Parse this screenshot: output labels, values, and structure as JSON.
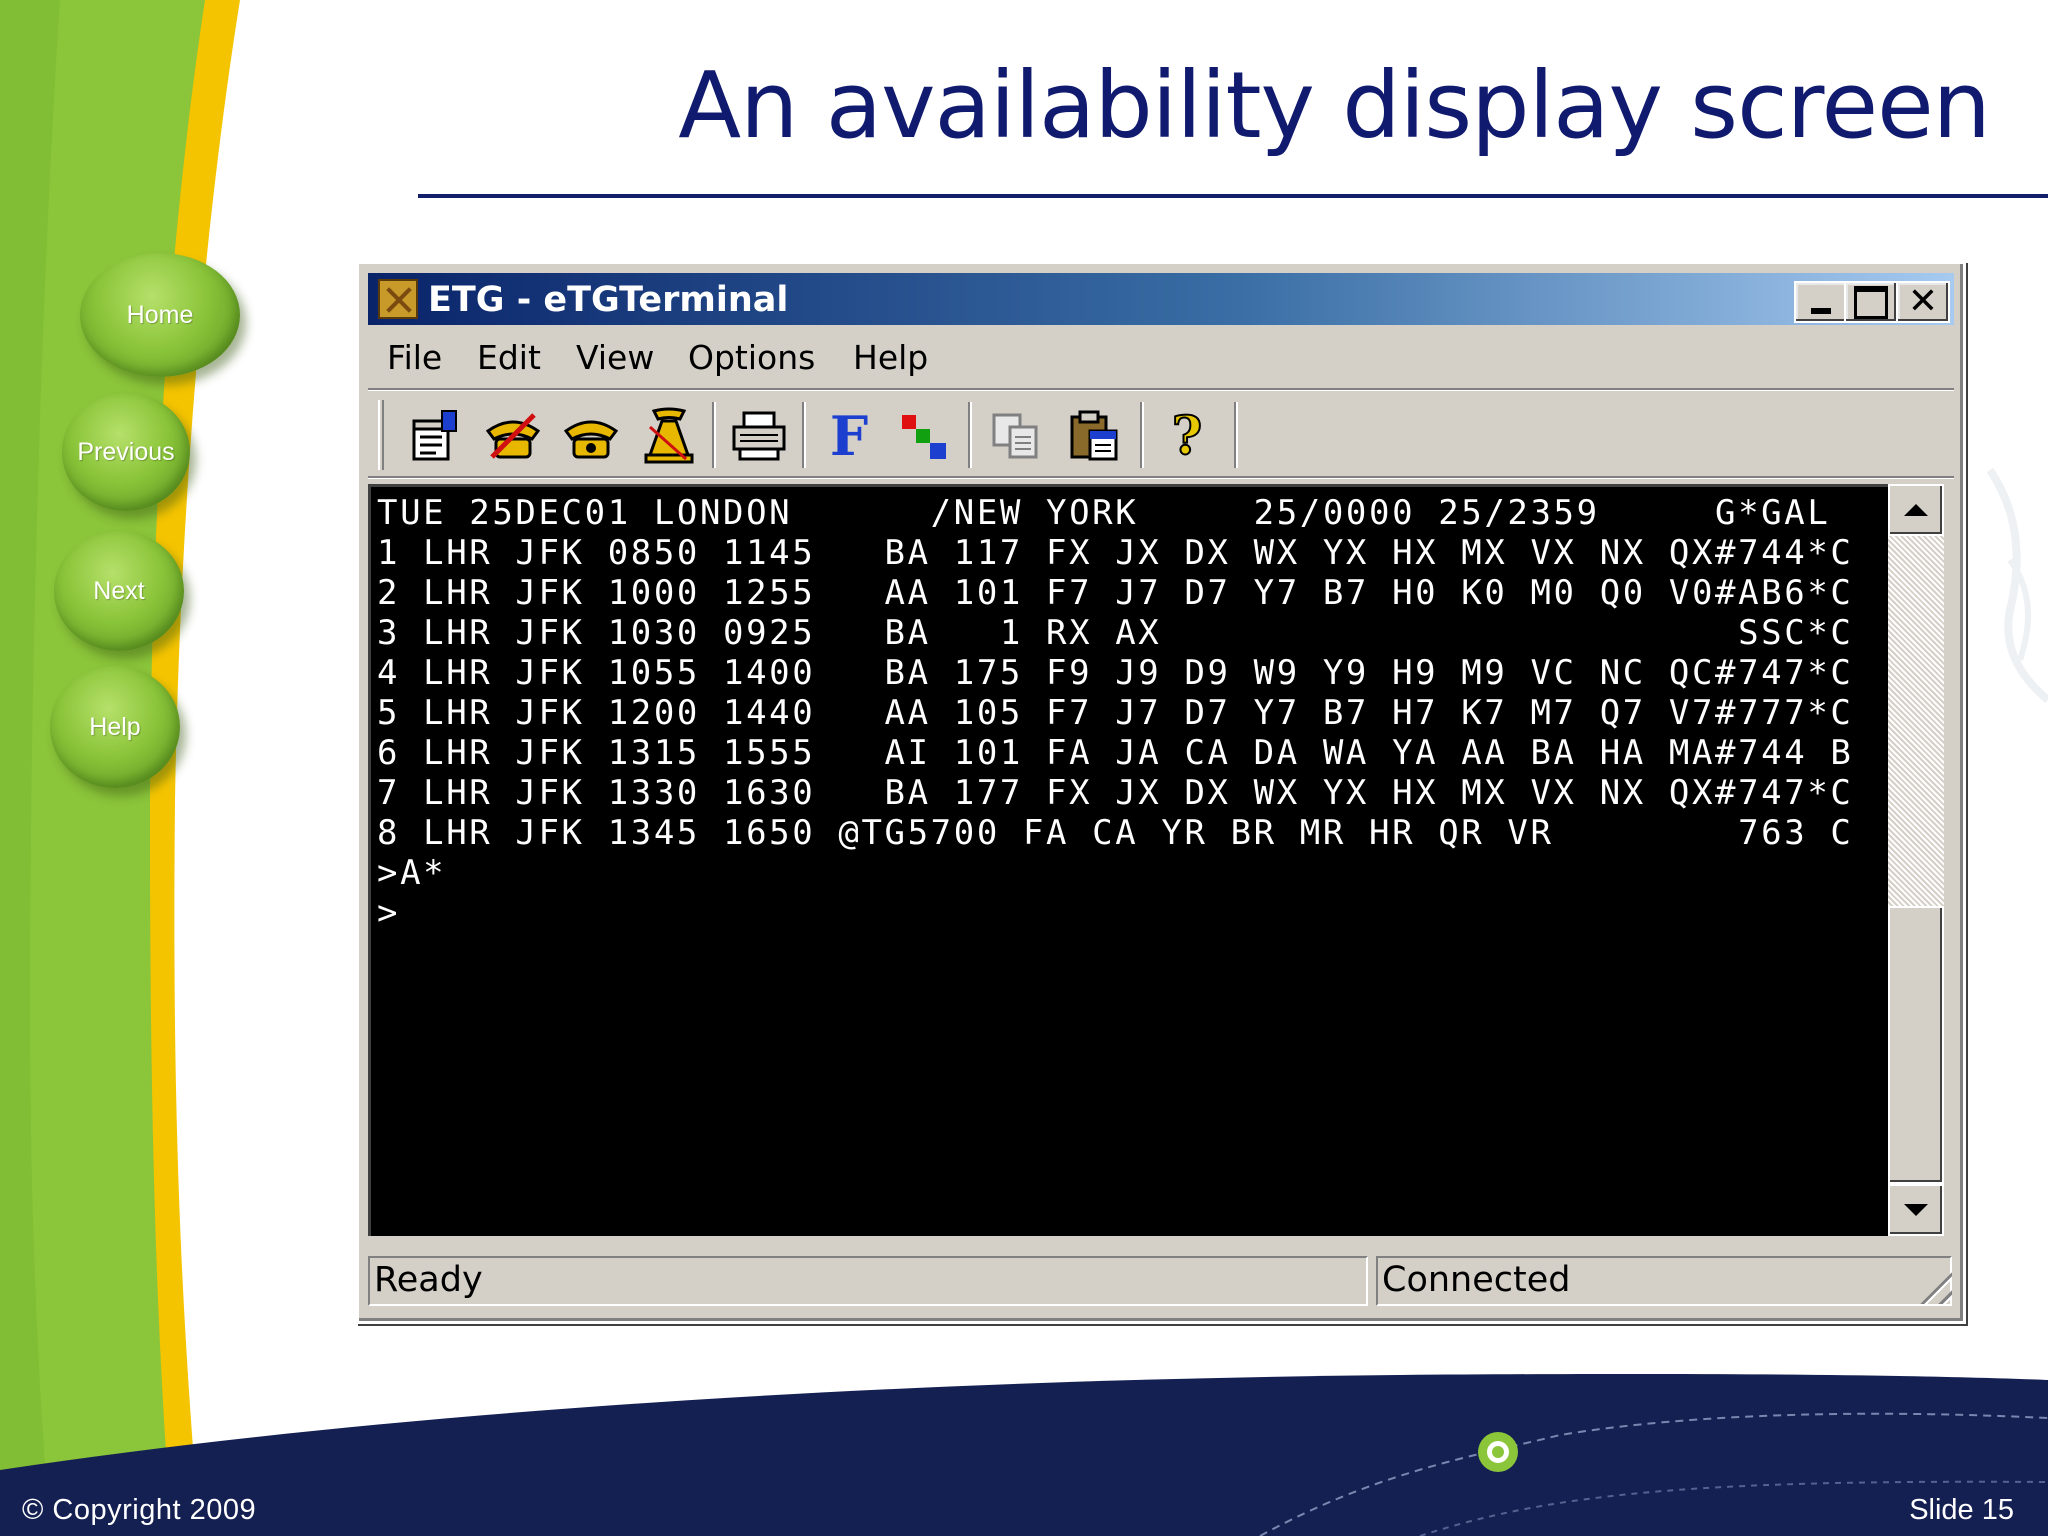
{
  "slide": {
    "title": "An availability display screen",
    "nav": [
      "Home",
      "Previous",
      "Next",
      "Help"
    ],
    "footer_copyright": "© Copyright 2009",
    "footer_slide": "Slide 15"
  },
  "window": {
    "title": "ETG - eTGTerminal",
    "controls": {
      "minimize": "",
      "maximize": "",
      "close": "✕"
    },
    "menu": [
      "File",
      "Edit",
      "View",
      "Options",
      "Help"
    ],
    "toolbar_icons": [
      "properties-icon",
      "disconnect-icon",
      "connect-phone-icon",
      "dial-phone-icon",
      "print-icon",
      "font-icon",
      "colors-icon",
      "copy-icon",
      "paste-icon",
      "help-icon"
    ],
    "toolbar_glyphs": {
      "font": "F",
      "help": "?"
    },
    "terminal_lines": [
      "TUE 25DEC01 LONDON      /NEW YORK     25/0000 25/2359     G*GAL",
      "1 LHR JFK 0850 1145   BA 117 FX JX DX WX YX HX MX VX NX QX#744*C",
      "2 LHR JFK 1000 1255   AA 101 F7 J7 D7 Y7 B7 H0 K0 M0 Q0 V0#AB6*C",
      "3 LHR JFK 1030 0925   BA   1 RX AX                         SSC*C",
      "4 LHR JFK 1055 1400   BA 175 F9 J9 D9 W9 Y9 H9 M9 VC NC QC#747*C",
      "5 LHR JFK 1200 1440   AA 105 F7 J7 D7 Y7 B7 H7 K7 M7 Q7 V7#777*C",
      "6 LHR JFK 1315 1555   AI 101 FA JA CA DA WA YA AA BA HA MA#744 B",
      "7 LHR JFK 1330 1630   BA 177 FX JX DX WX YX HX MX VX NX QX#747*C",
      "8 LHR JFK 1345 1650 @TG5700 FA CA YR BR MR HR QR VR        763 C",
      ">A*",
      ">"
    ],
    "status": {
      "left": "Ready",
      "right": "Connected"
    }
  },
  "colors": {
    "title_blue": "#101a6e",
    "slide_green": "#8bc53a",
    "slide_yellow": "#f5c400",
    "footer_navy": "#152052",
    "terminal_bg": "#000000",
    "terminal_fg": "#ffffff"
  }
}
